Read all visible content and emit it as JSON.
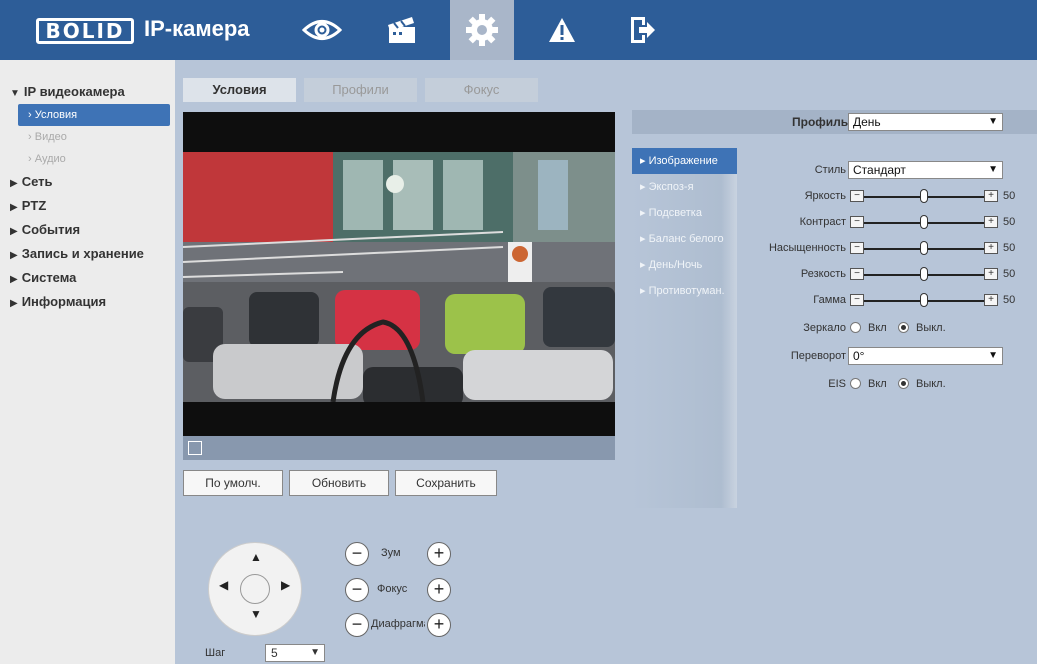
{
  "header": {
    "logo": "BOLID",
    "title": "IP-камера",
    "nav": [
      {
        "name": "live-view",
        "icon": "eye-icon"
      },
      {
        "name": "playback",
        "icon": "clapperboard-icon"
      },
      {
        "name": "settings",
        "icon": "gear-icon",
        "active": true
      },
      {
        "name": "alarm",
        "icon": "warning-icon"
      },
      {
        "name": "logout",
        "icon": "exit-icon"
      }
    ]
  },
  "sidebar": {
    "groups": [
      {
        "label": "IP видеокамера",
        "expanded": true,
        "items": [
          "Условия",
          "Видео",
          "Аудио"
        ]
      },
      {
        "label": "Сеть"
      },
      {
        "label": "PTZ"
      },
      {
        "label": "События"
      },
      {
        "label": "Запись и хранение"
      },
      {
        "label": "Система"
      },
      {
        "label": "Информация"
      }
    ]
  },
  "tabs": [
    "Условия",
    "Профили",
    "Фокус"
  ],
  "buttons": {
    "default": "По умолч.",
    "refresh": "Обновить",
    "save": "Сохранить"
  },
  "ptz": {
    "zoom": "Зум",
    "focus": "Фокус",
    "iris": "Диафрагма",
    "step_label": "Шаг",
    "step_value": "5"
  },
  "settings": {
    "profile_label": "Профиль",
    "profile_value": "День",
    "menu": [
      "Изображение",
      "Экспоз-я",
      "Подсветка",
      "Баланс белого",
      "День/Ночь",
      "Противотуман."
    ],
    "style_label": "Стиль",
    "style_value": "Стандарт",
    "sliders": [
      {
        "label": "Яркость",
        "value": "50"
      },
      {
        "label": "Контраст",
        "value": "50"
      },
      {
        "label": "Насыщенность",
        "value": "50"
      },
      {
        "label": "Резкость",
        "value": "50"
      },
      {
        "label": "Гамма",
        "value": "50"
      }
    ],
    "mirror_label": "Зеркало",
    "on_label": "Вкл",
    "off_label": "Выкл.",
    "flip_label": "Переворот",
    "flip_value": "0°",
    "eis_label": "EIS"
  }
}
